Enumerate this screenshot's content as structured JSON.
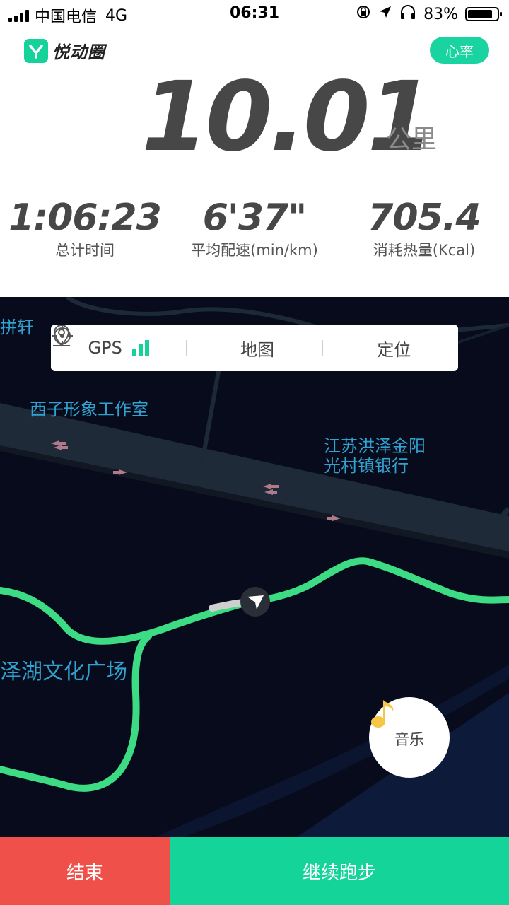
{
  "status_bar": {
    "carrier": "中国电信",
    "network": "4G",
    "time": "06:31",
    "battery_percent": "83%"
  },
  "header": {
    "app_name": "悦动圈",
    "heart_rate_button": "心率"
  },
  "run": {
    "distance_value": "10.01",
    "distance_unit": "公里",
    "stats": [
      {
        "value": "1:06:23",
        "label": "总计时间"
      },
      {
        "value": "6'37\"",
        "label": "平均配速(min/km)"
      },
      {
        "value": "705.4",
        "label": "消耗热量(Kcal)"
      }
    ]
  },
  "map": {
    "toolbar": {
      "gps_label": "GPS",
      "map_label": "地图",
      "locate_label": "定位"
    },
    "labels": [
      "拼轩",
      "西子形象工作室",
      "江苏洪泽金阳",
      "光村镇银行",
      "泽湖文化广场"
    ],
    "music_label": "音乐"
  },
  "actions": {
    "end_label": "结束",
    "continue_label": "继续跑步"
  },
  "colors": {
    "accent": "#15d49a",
    "end": "#f0504a",
    "map_bg": "#070b1b",
    "route": "#3ddc84",
    "map_text": "#31a2cf"
  }
}
